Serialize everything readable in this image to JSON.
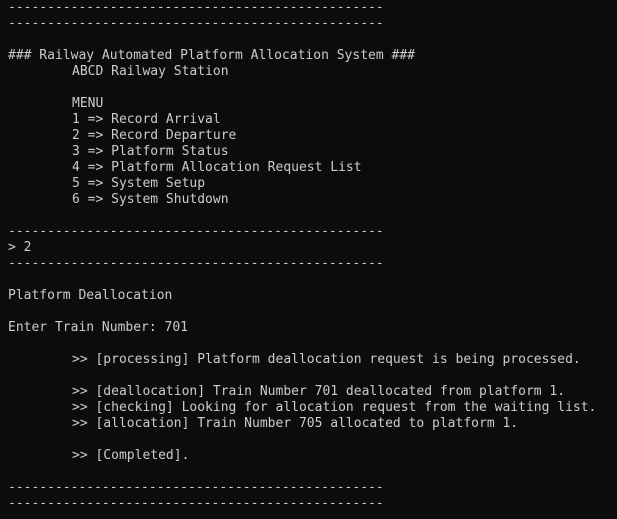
{
  "colors": {
    "background": "#0c0c0c",
    "foreground": "#cccccc"
  },
  "rule": "------------------------------------------------",
  "header": {
    "title": "### Railway Automated Platform Allocation System ###",
    "station": "ABCD Railway Station"
  },
  "menu": {
    "heading": "MENU",
    "items": [
      "1 => Record Arrival",
      "2 => Record Departure",
      "3 => Platform Status",
      "4 => Platform Allocation Request List",
      "5 => System Setup",
      "6 => System Shutdown"
    ]
  },
  "prompt": {
    "input": "> 2"
  },
  "section": {
    "title": "Platform Deallocation",
    "train_prompt": "Enter Train Number: 701"
  },
  "log": {
    "processing": ">> [processing] Platform deallocation request is being processed.",
    "deallocation": ">> [deallocation] Train Number 701 deallocated from platform 1.",
    "checking": ">> [checking] Looking for allocation request from the waiting list.",
    "allocation": ">> [allocation] Train Number 705 allocated to platform 1.",
    "completed": ">> [Completed]."
  }
}
